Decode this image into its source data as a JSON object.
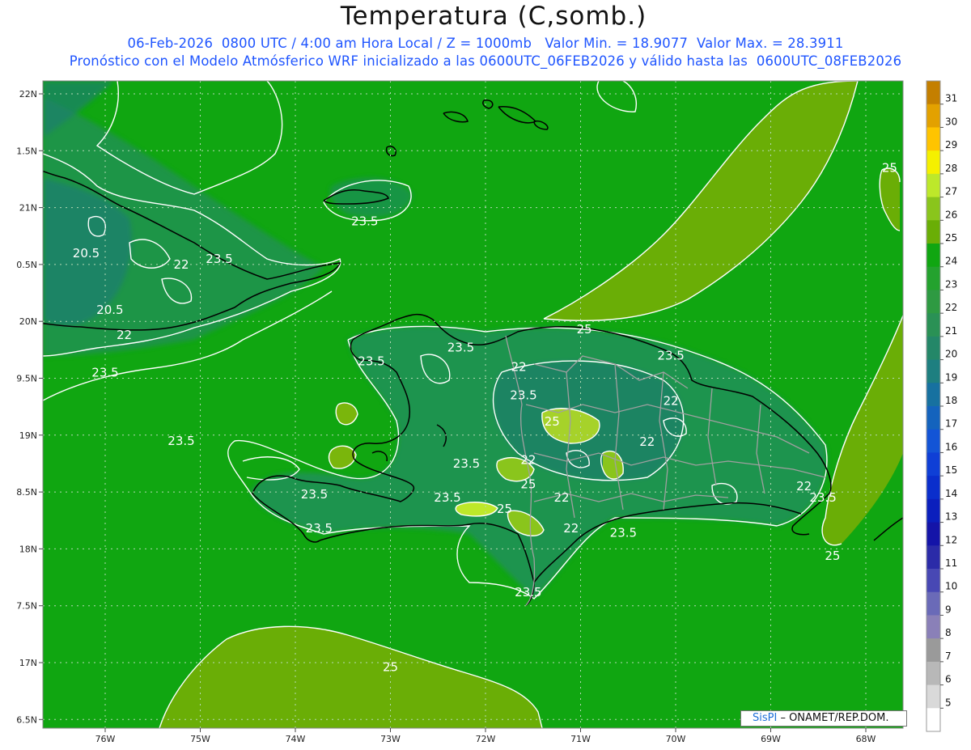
{
  "header": {
    "title": "Temperatura (C,somb.)",
    "subtitle_line1": "06-Feb-2026  0800 UTC / 4:00 am Hora Local / Z = 1000mb   Valor Min. = 18.9077  Valor Max. = 28.3911",
    "subtitle_line2": "Pronóstico con el Modelo Atmósferico WRF inicializado a las 0600UTC_06FEB2026 y válido hasta las  0600UTC_08FEB2026"
  },
  "axes": {
    "lat_ticks": [
      "22N",
      "1.5N",
      "21N",
      "0.5N",
      "20N",
      "9.5N",
      "19N",
      "8.5N",
      "18N",
      "7.5N",
      "17N",
      "6.5N"
    ],
    "lon_ticks": [
      "76W",
      "75W",
      "74W",
      "73W",
      "72W",
      "71W",
      "70W",
      "69W",
      "68W"
    ]
  },
  "contour_labels": [
    {
      "text": "23.5",
      "lon": -73.27,
      "lat": 20.88
    },
    {
      "text": "20.5",
      "lon": -76.2,
      "lat": 20.6
    },
    {
      "text": "22",
      "lon": -75.2,
      "lat": 20.5
    },
    {
      "text": "23.5",
      "lon": -74.8,
      "lat": 20.55
    },
    {
      "text": "20.5",
      "lon": -75.95,
      "lat": 20.1
    },
    {
      "text": "22",
      "lon": -75.8,
      "lat": 19.88
    },
    {
      "text": "23.5",
      "lon": -76.0,
      "lat": 19.55
    },
    {
      "text": "23.5",
      "lon": -73.2,
      "lat": 19.65
    },
    {
      "text": "23.5",
      "lon": -72.26,
      "lat": 19.77
    },
    {
      "text": "22",
      "lon": -71.65,
      "lat": 19.6
    },
    {
      "text": "25",
      "lon": -70.96,
      "lat": 19.93
    },
    {
      "text": "23.5",
      "lon": -70.05,
      "lat": 19.7
    },
    {
      "text": "22",
      "lon": -70.05,
      "lat": 19.3
    },
    {
      "text": "23.5",
      "lon": -71.6,
      "lat": 19.35
    },
    {
      "text": "25",
      "lon": -71.3,
      "lat": 19.12
    },
    {
      "text": "22",
      "lon": -70.3,
      "lat": 18.94
    },
    {
      "text": "23.5",
      "lon": -75.2,
      "lat": 18.95
    },
    {
      "text": "23.5",
      "lon": -72.2,
      "lat": 18.75
    },
    {
      "text": "22",
      "lon": -71.55,
      "lat": 18.78
    },
    {
      "text": "25",
      "lon": -71.55,
      "lat": 18.57
    },
    {
      "text": "23.5",
      "lon": -73.8,
      "lat": 18.48
    },
    {
      "text": "23.5",
      "lon": -72.4,
      "lat": 18.45
    },
    {
      "text": "22",
      "lon": -71.2,
      "lat": 18.45
    },
    {
      "text": "25",
      "lon": -71.8,
      "lat": 18.35
    },
    {
      "text": "22",
      "lon": -68.65,
      "lat": 18.55
    },
    {
      "text": "23.5",
      "lon": -68.45,
      "lat": 18.45
    },
    {
      "text": "23.5",
      "lon": -73.75,
      "lat": 18.18
    },
    {
      "text": "22",
      "lon": -71.1,
      "lat": 18.18
    },
    {
      "text": "23.5",
      "lon": -70.55,
      "lat": 18.14
    },
    {
      "text": "23.5",
      "lon": -71.55,
      "lat": 17.62
    },
    {
      "text": "25",
      "lon": -68.35,
      "lat": 17.94
    },
    {
      "text": "25",
      "lon": -67.4,
      "lat": 20.85
    },
    {
      "text": "25",
      "lon": -67.75,
      "lat": 21.35
    },
    {
      "text": "25",
      "lon": -73.0,
      "lat": 16.96
    }
  ],
  "colorbar": {
    "labels": [
      "31",
      "30",
      "29",
      "28",
      "27",
      "26",
      "25",
      "24",
      "23",
      "22",
      "21",
      "20",
      "19",
      "18",
      "17",
      "16",
      "15",
      "14",
      "13",
      "12",
      "11",
      "10",
      "9",
      "8",
      "7",
      "6",
      "5"
    ],
    "colors": [
      "#c47f00",
      "#e3a100",
      "#ffc400",
      "#f5f000",
      "#bde82a",
      "#8ac51c",
      "#6aae06",
      "#10a611",
      "#24a22e",
      "#2e9a42",
      "#2a9155",
      "#248768",
      "#1e7f80",
      "#1771a0",
      "#1463bd",
      "#1354d6",
      "#0f3fd6",
      "#0a2ecc",
      "#0b1fbd",
      "#1414a8",
      "#2b2ba8",
      "#4848b4",
      "#6a6ab8",
      "#8a80b8",
      "#9a9a9a",
      "#b8b8b8",
      "#d9d9d9",
      "#ffffff"
    ]
  },
  "credit": {
    "brand": "SisPI",
    "text": " – ONAMET/REP.DOM."
  },
  "colors": {
    "ocean_green": "#10a611",
    "warm_band": "#6aae06",
    "cool_teal": "#248768",
    "contour": "#ffffff",
    "coast": "#000000",
    "border": "#a0a0a0",
    "subtitle_blue": "#1f55ff"
  }
}
